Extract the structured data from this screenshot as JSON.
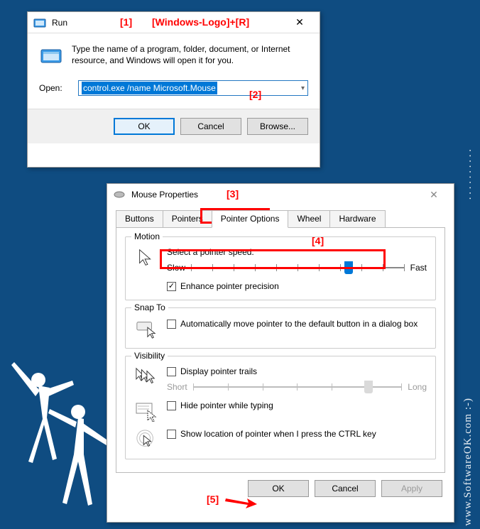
{
  "annotations": {
    "a1": "[1]",
    "a1_text": "[Windows-Logo]+[R]",
    "a2": "[2]",
    "a3": "[3]",
    "a4": "[4]",
    "a5": "[5]"
  },
  "run": {
    "title": "Run",
    "prompt": "Type the name of a program, folder, document, or Internet resource, and Windows will open it for you.",
    "open_label": "Open:",
    "value": "control.exe /name Microsoft.Mouse",
    "ok": "OK",
    "cancel": "Cancel",
    "browse": "Browse..."
  },
  "mp": {
    "title": "Mouse Properties",
    "tabs": {
      "buttons": "Buttons",
      "pointers": "Pointers",
      "pointer_options": "Pointer Options",
      "wheel": "Wheel",
      "hardware": "Hardware"
    },
    "motion": {
      "legend": "Motion",
      "label": "Select a pointer speed:",
      "slow": "Slow",
      "fast": "Fast",
      "enhance": "Enhance pointer precision"
    },
    "snap": {
      "legend": "Snap To",
      "label": "Automatically move pointer to the default button in a dialog box"
    },
    "vis": {
      "legend": "Visibility",
      "trails": "Display pointer trails",
      "short": "Short",
      "long": "Long",
      "hide": "Hide pointer while typing",
      "ctrl": "Show location of pointer when I press the CTRL key"
    },
    "ok": "OK",
    "cancel": "Cancel",
    "apply": "Apply"
  },
  "watermark": "www.SoftwareOK.com :-)",
  "watermark_dots": ". . . . . . . . . ."
}
